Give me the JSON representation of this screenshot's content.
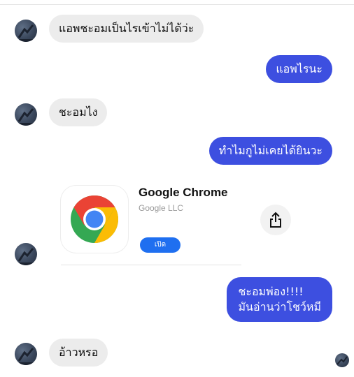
{
  "messages": {
    "m1": "แอพชะอมเป็นไรเข้าไม่ได้ว่ะ",
    "m2": "แอพไรนะ",
    "m3": "ชะอมไง",
    "m4": "ทำไมกูไม่เคยได้ยินวะ",
    "m5_line1": "ชะอมพ่อง!!!!",
    "m5_line2": "มันอ่านว่าโชว์หมี",
    "m6": "อ้าวหรอ"
  },
  "app_card": {
    "name": "Google Chrome",
    "developer": "Google LLC",
    "open_label": "เปิด",
    "icon": "chrome-logo",
    "share_icon": "share-icon"
  },
  "colors": {
    "outgoing_bubble": "#3d4fe0",
    "incoming_bubble": "#ececec",
    "open_button": "#1f6ff0"
  }
}
